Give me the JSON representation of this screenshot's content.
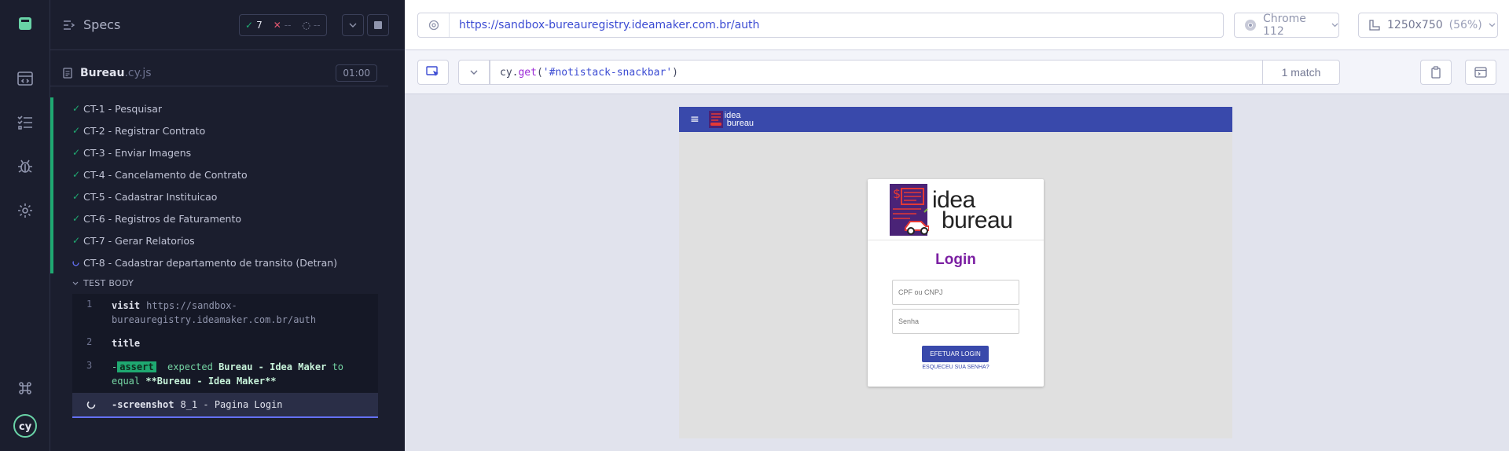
{
  "nav": {
    "items": [
      {
        "name": "specs-nav-icon"
      },
      {
        "name": "runs-nav-icon"
      },
      {
        "name": "debug-nav-icon"
      },
      {
        "name": "settings-nav-icon"
      }
    ],
    "shortcut_icon": "command-icon",
    "logo_text": "cy"
  },
  "reporter": {
    "title": "Specs",
    "stats": {
      "passed": "7",
      "failed": "--",
      "pending": "--"
    },
    "file": {
      "name": "Bureau",
      "ext": ".cy.js",
      "duration": "01:00"
    },
    "tests": [
      {
        "label": "CT-1 - Pesquisar",
        "state": "passed"
      },
      {
        "label": "CT-2 - Registrar Contrato",
        "state": "passed"
      },
      {
        "label": "CT-3 - Enviar Imagens",
        "state": "passed"
      },
      {
        "label": "CT-4 - Cancelamento de Contrato",
        "state": "passed"
      },
      {
        "label": "CT-5 - Cadastrar Instituicao",
        "state": "passed"
      },
      {
        "label": "CT-6 - Registros de Faturamento",
        "state": "passed"
      },
      {
        "label": "CT-7 - Gerar Relatorios",
        "state": "passed"
      },
      {
        "label": "CT-8 - Cadastrar departamento de transito (Detran)",
        "state": "running"
      }
    ],
    "test_body_label": "TEST BODY",
    "commands": [
      {
        "num": "1",
        "name": "visit",
        "arg": "https://sandbox-",
        "arg2": "bureauregistry.ideamaker.com.br/auth"
      },
      {
        "num": "2",
        "name": "title"
      },
      {
        "num": "3",
        "prefix": "-",
        "badge": "assert",
        "line1": "expected ",
        "strong1": "Bureau - Idea Maker",
        "line1b": " to",
        "line2": "equal ",
        "strong2": "**Bureau - Idea Maker**"
      },
      {
        "name": "-screenshot",
        "arg": "8_1 - Pagina Login"
      }
    ]
  },
  "toolbar": {
    "url": "https://sandbox-bureauregistry.ideamaker.com.br/auth",
    "browser": "Chrome 112",
    "viewport": "1250x750",
    "scale": "(56%)"
  },
  "selector": {
    "prefix": "cy.",
    "fn": "get",
    "open": "(",
    "arg": "'#notistack-snackbar'",
    "close": ")",
    "match": "1 match"
  },
  "aut": {
    "bar_logo_line1": "idea",
    "bar_logo_line2": "bureau",
    "logo_line1": "idea",
    "logo_line2": "bureau",
    "heading": "Login",
    "cpf_placeholder": "CPF ou CNPJ",
    "password_placeholder": "Senha",
    "login_button": "EFETUAR LOGIN",
    "forgot_link": "ESQUECEU SUA SENHA?"
  },
  "colors": {
    "pass": "#1fa971",
    "fail": "#e45770",
    "accent": "#3c4cd3",
    "app_bar": "#3949ab",
    "login_heading": "#7b1fa2"
  }
}
